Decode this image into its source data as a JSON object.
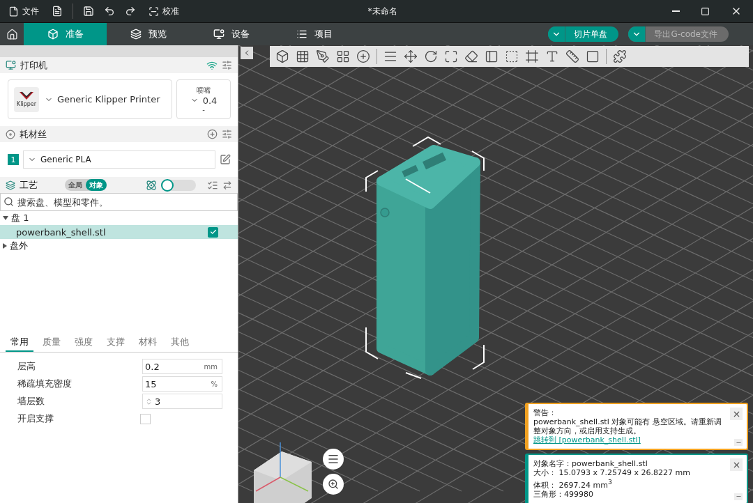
{
  "menu": {
    "file": "文件",
    "calibrate": "校准"
  },
  "window": {
    "title": "*未命名"
  },
  "main_tabs": [
    {
      "label": "准备",
      "selected": true
    },
    {
      "label": "预览",
      "selected": false
    },
    {
      "label": "设备",
      "selected": false
    },
    {
      "label": "项目",
      "selected": false
    }
  ],
  "actions": [
    {
      "label": "切片单盘",
      "disabled": false
    },
    {
      "label": "导出G-code文件",
      "disabled": true
    }
  ],
  "printer": {
    "title": "打印机",
    "logo_text": "Klipper",
    "name": "Generic Klipper Printer",
    "nozzle_label": "喷嘴",
    "nozzle": "0.4",
    "nozzle_sub": "-"
  },
  "filament": {
    "title": "耗材丝",
    "slots": [
      {
        "index": "1",
        "name": "Generic PLA"
      }
    ]
  },
  "process": {
    "title": "工艺",
    "scope": [
      {
        "label": "全局",
        "selected": false
      },
      {
        "label": "对象",
        "selected": true
      }
    ],
    "advanced": false
  },
  "search": {
    "placeholder": "搜索盘、模型和零件。"
  },
  "tree": [
    {
      "label": "盘 1",
      "expanded": true,
      "children": [
        {
          "label": "powerbank_shell.stl",
          "selected": true,
          "checked": true
        }
      ]
    },
    {
      "label": "盘外",
      "expanded": false
    }
  ],
  "settings_tabs": [
    {
      "label": "常用",
      "selected": true
    },
    {
      "label": "质量",
      "selected": false
    },
    {
      "label": "强度",
      "selected": false
    },
    {
      "label": "支撑",
      "selected": false
    },
    {
      "label": "材料",
      "selected": false
    },
    {
      "label": "其他",
      "selected": false
    }
  ],
  "settings": [
    {
      "kind": "number",
      "label": "层高",
      "value": "0.2",
      "unit": "mm"
    },
    {
      "kind": "number",
      "label": "稀疏填充密度",
      "value": "15",
      "unit": "%"
    },
    {
      "kind": "spin",
      "label": "墙层数",
      "value": "3"
    },
    {
      "kind": "checkbox",
      "label": "开启支撑",
      "checked": false
    }
  ],
  "notifications": [
    {
      "kind": "warning",
      "color": "#f0a020",
      "title": "警告：",
      "message": "powerbank_shell.stl 对象可能有 悬空区域。请重新调整对象方向，或启用支持生成。",
      "link": "跳转到 [powerbank_shell.stl]"
    },
    {
      "kind": "info",
      "color": "#009688",
      "lines": [
        "对象名字：powerbank_shell.stl",
        "大小：  15.0793 x 7.25749 x 26.8227 mm",
        "体积：  2697.24 mm$^{3}$",
        "三角形：499980"
      ]
    }
  ]
}
